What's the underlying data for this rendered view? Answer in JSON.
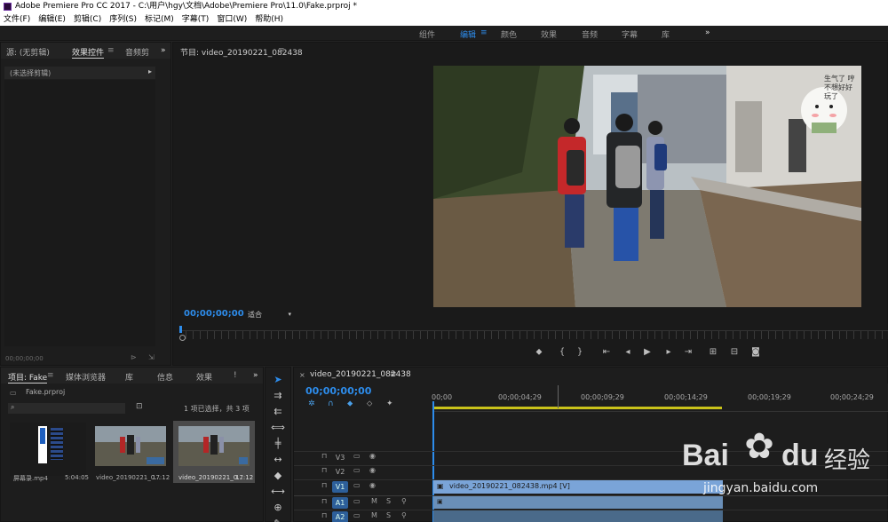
{
  "window": {
    "title": "Adobe Premiere Pro CC 2017 - C:\\用户\\hgy\\文档\\Adobe\\Premiere Pro\\11.0\\Fake.prproj *"
  },
  "menu": [
    "文件(F)",
    "编辑(E)",
    "剪辑(C)",
    "序列(S)",
    "标记(M)",
    "字幕(T)",
    "窗口(W)",
    "帮助(H)"
  ],
  "workspaces": {
    "items": [
      "组件",
      "编辑",
      "颜色",
      "效果",
      "音频",
      "字幕",
      "库"
    ],
    "active": "编辑",
    "more": "»"
  },
  "source_panel": {
    "tabs": [
      "源: (无剪辑)",
      "效果控件",
      "音频剪"
    ],
    "empty_label": "(未选择剪辑)",
    "timecode": "00;00;00;00",
    "expand": "»"
  },
  "program_panel": {
    "title": "节目: video_20190221_082438",
    "timecode": "00;00;00;00",
    "fit": "适合",
    "video_overlay_text": "生气了 哼 不想好好 玩了"
  },
  "project_panel": {
    "tabs": [
      "项目: Fake",
      "媒体浏览器",
      "库",
      "信息",
      "效果",
      "!"
    ],
    "project_file": "Fake.prproj",
    "selection_info": "1 项已选择，共 3 项",
    "items": [
      {
        "name": "屏幕录.mp4",
        "duration": "5:04:05"
      },
      {
        "name": "video_20190221_0...",
        "duration": "17:12"
      },
      {
        "name": "video_20190221_0...",
        "duration": "17:12"
      }
    ]
  },
  "timeline": {
    "tab": "video_20190221_082438",
    "timecode": "00;00;00;00",
    "ruler": [
      "00;00",
      "00;00;04;29",
      "00;00;09;29",
      "00;00;14;29",
      "00;00;19;29",
      "00;00;24;29"
    ],
    "tracks": [
      {
        "name": "V3",
        "active": false
      },
      {
        "name": "V2",
        "active": false
      },
      {
        "name": "V1",
        "active": true
      },
      {
        "name": "A1",
        "active": true
      },
      {
        "name": "A2",
        "active": true
      }
    ],
    "clip_label": "video_20190221_082438.mp4 [V]",
    "track_buttons": {
      "mute": "M",
      "solo": "S"
    }
  },
  "watermark": {
    "brand": "Bai",
    "brand2": "du",
    "cn": "经验",
    "url": "jingyan.baidu.com"
  },
  "colors": {
    "accent": "#2d8ceb",
    "clip": "#7aa4d8",
    "yellow_bar": "#c9c21a"
  }
}
